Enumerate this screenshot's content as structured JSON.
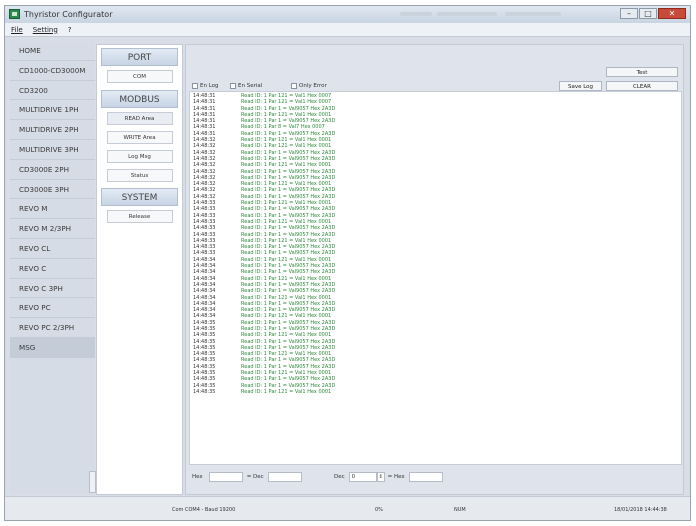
{
  "window": {
    "title": "Thyristor Configurator"
  },
  "menu": [
    "File",
    "Setting",
    "?"
  ],
  "sidebar": {
    "items": [
      {
        "label": "HOME"
      },
      {
        "label": "CD1000-CD3000M"
      },
      {
        "label": "CD3200"
      },
      {
        "label": "MULTIDRIVE 1PH"
      },
      {
        "label": "MULTIDRIVE 2PH"
      },
      {
        "label": "MULTIDRIVE 3PH"
      },
      {
        "label": "CD3000E 2PH"
      },
      {
        "label": "CD3000E 3PH"
      },
      {
        "label": "REVO M"
      },
      {
        "label": "REVO M 2/3PH"
      },
      {
        "label": "REVO CL"
      },
      {
        "label": "REVO C"
      },
      {
        "label": "REVO C 3PH"
      },
      {
        "label": "REVO PC"
      },
      {
        "label": "REVO PC 2/3PH"
      },
      {
        "label": "MSG"
      }
    ],
    "selected": "MSG"
  },
  "panel": {
    "port_header": "PORT",
    "com_button": "COM",
    "modbus_header": "MODBUS",
    "read_area": "READ Area",
    "write_area": "WRITE Area",
    "log_msg": "Log Msg",
    "status": "Status",
    "system_header": "SYSTEM",
    "release": "Release"
  },
  "toolbar": {
    "test_button": "Test",
    "save_log_button": "Save Log",
    "clear_button": "CLEAR",
    "chk_en_log": "En Log",
    "chk_en_serial": "En Serial",
    "chk_only_error": "Only Error"
  },
  "log": [
    {
      "time": "14:48:31",
      "msg": "Read ID: 1 Par 121 = Val1 Hex 0007"
    },
    {
      "time": "14:48:31",
      "msg": "Read ID: 1 Par 121 = Val1 Hex 0007"
    },
    {
      "time": "14:48:31",
      "msg": "Read ID: 1 Par 1 = Val9057 Hex 2A3D"
    },
    {
      "time": "14:48:31",
      "msg": "Read ID: 1 Par 121 = Val1 Hex 0001"
    },
    {
      "time": "14:48:31",
      "msg": "Read ID: 1 Par 1 = Val9057 Hex 2A3D"
    },
    {
      "time": "14:48:31",
      "msg": "Read ID: 1 Par 8 = Val7 Hex 0007"
    },
    {
      "time": "14:48:31",
      "msg": "Read ID: 1 Par 1 = Val9057 Hex 2A3D"
    },
    {
      "time": "14:48:32",
      "msg": "Read ID: 1 Par 121 = Val1 Hex 0001"
    },
    {
      "time": "14:48:32",
      "msg": "Read ID: 1 Par 121 = Val1 Hex 0001"
    },
    {
      "time": "14:48:32",
      "msg": "Read ID: 1 Par 1 = Val9057 Hex 2A3D"
    },
    {
      "time": "14:48:32",
      "msg": "Read ID: 1 Par 1 = Val9057 Hex 2A3D"
    },
    {
      "time": "14:48:32",
      "msg": "Read ID: 1 Par 121 = Val1 Hex 0001"
    },
    {
      "time": "14:48:32",
      "msg": "Read ID: 1 Par 1 = Val9057 Hex 2A3D"
    },
    {
      "time": "14:48:32",
      "msg": "Read ID: 1 Par 1 = Val9057 Hex 2A3D"
    },
    {
      "time": "14:48:32",
      "msg": "Read ID: 1 Par 121 = Val1 Hex 0001"
    },
    {
      "time": "14:48:32",
      "msg": "Read ID: 1 Par 1 = Val9057 Hex 2A3D"
    },
    {
      "time": "14:48:32",
      "msg": "Read ID: 1 Par 1 = Val9057 Hex 2A3D"
    },
    {
      "time": "14:48:33",
      "msg": "Read ID: 1 Par 121 = Val1 Hex 0001"
    },
    {
      "time": "14:48:33",
      "msg": "Read ID: 1 Par 1 = Val9057 Hex 2A3D"
    },
    {
      "time": "14:48:33",
      "msg": "Read ID: 1 Par 1 = Val9057 Hex 2A3D"
    },
    {
      "time": "14:48:33",
      "msg": "Read ID: 1 Par 121 = Val1 Hex 0001"
    },
    {
      "time": "14:48:33",
      "msg": "Read ID: 1 Par 1 = Val9057 Hex 2A3D"
    },
    {
      "time": "14:48:33",
      "msg": "Read ID: 1 Par 1 = Val9057 Hex 2A3D"
    },
    {
      "time": "14:48:33",
      "msg": "Read ID: 1 Par 121 = Val1 Hex 0001"
    },
    {
      "time": "14:48:33",
      "msg": "Read ID: 1 Par 1 = Val9057 Hex 2A3D"
    },
    {
      "time": "14:48:33",
      "msg": "Read ID: 1 Par 1 = Val9057 Hex 2A3D"
    },
    {
      "time": "14:48:34",
      "msg": "Read ID: 1 Par 121 = Val1 Hex 0001"
    },
    {
      "time": "14:48:34",
      "msg": "Read ID: 1 Par 1 = Val9057 Hex 2A3D"
    },
    {
      "time": "14:48:34",
      "msg": "Read ID: 1 Par 1 = Val9057 Hex 2A3D"
    },
    {
      "time": "14:48:34",
      "msg": "Read ID: 1 Par 121 = Val1 Hex 0001"
    },
    {
      "time": "14:48:34",
      "msg": "Read ID: 1 Par 1 = Val9057 Hex 2A3D"
    },
    {
      "time": "14:48:34",
      "msg": "Read ID: 1 Par 1 = Val9057 Hex 2A3D"
    },
    {
      "time": "14:48:34",
      "msg": "Read ID: 1 Par 121 = Val1 Hex 0001"
    },
    {
      "time": "14:48:34",
      "msg": "Read ID: 1 Par 1 = Val9057 Hex 2A3D"
    },
    {
      "time": "14:48:34",
      "msg": "Read ID: 1 Par 1 = Val9057 Hex 2A3D"
    },
    {
      "time": "14:48:34",
      "msg": "Read ID: 1 Par 121 = Val1 Hex 0001"
    },
    {
      "time": "14:48:35",
      "msg": "Read ID: 1 Par 1 = Val9057 Hex 2A3D"
    },
    {
      "time": "14:48:35",
      "msg": "Read ID: 1 Par 1 = Val9057 Hex 2A3D"
    },
    {
      "time": "14:48:35",
      "msg": "Read ID: 1 Par 121 = Val1 Hex 0001"
    },
    {
      "time": "14:48:35",
      "msg": "Read ID: 1 Par 1 = Val9057 Hex 2A3D"
    },
    {
      "time": "14:48:35",
      "msg": "Read ID: 1 Par 1 = Val9057 Hex 2A3D"
    },
    {
      "time": "14:48:35",
      "msg": "Read ID: 1 Par 121 = Val1 Hex 0001"
    },
    {
      "time": "14:48:35",
      "msg": "Read ID: 1 Par 1 = Val9057 Hex 2A3D"
    },
    {
      "time": "14:48:35",
      "msg": "Read ID: 1 Par 1 = Val9057 Hex 2A3D"
    },
    {
      "time": "14:48:35",
      "msg": "Read ID: 1 Par 121 = Val1 Hex 0001"
    },
    {
      "time": "14:48:35",
      "msg": "Read ID: 1 Par 1 = Val9057 Hex 2A3D"
    },
    {
      "time": "14:48:35",
      "msg": "Read ID: 1 Par 1 = Val9057 Hex 2A3D"
    },
    {
      "time": "14:48:35",
      "msg": "Read ID: 1 Par 121 = Val1 Hex 0001"
    }
  ],
  "converter": {
    "hex_label": "Hex",
    "dec_label": "= Dec",
    "dec2_label": "Dec",
    "dec2_value": "0",
    "hex2_label": "= Hex"
  },
  "status": {
    "com": "Com COM4 - Baud 19200",
    "percent": "0%",
    "num": "NUM",
    "datetime": "18/01/2018 14:44:38"
  }
}
